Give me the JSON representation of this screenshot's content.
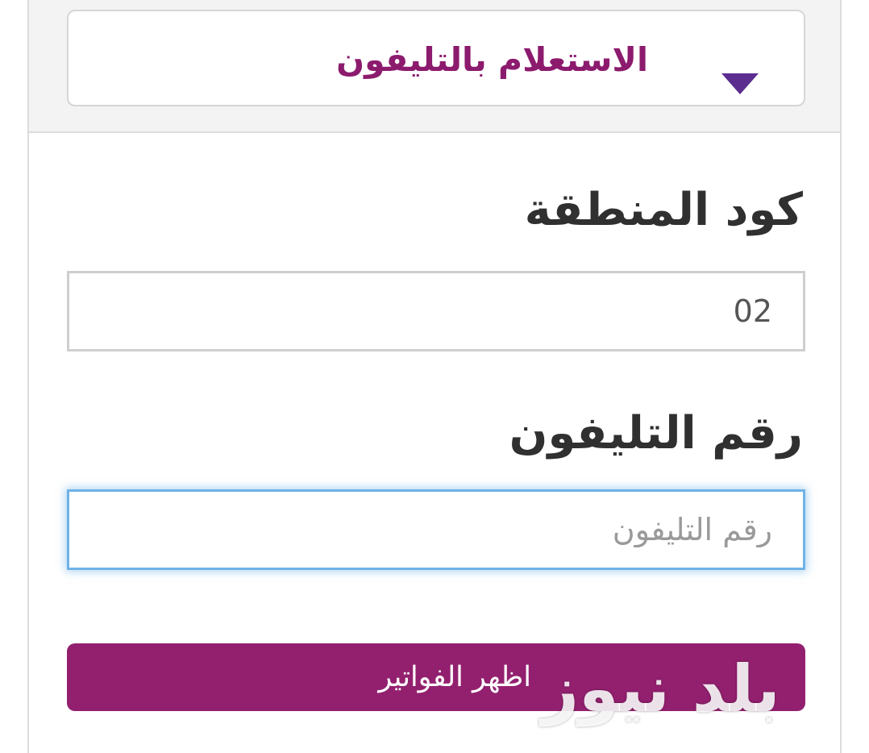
{
  "inquiry": {
    "method_label": "الاستعلام بالتليفون",
    "dropdown_icon": "triangle-down-icon",
    "accent_color": "#8c1b6e",
    "arrow_color": "#5a2d8f"
  },
  "form": {
    "area_code_label": "كود المنطقة",
    "area_code_value": "02",
    "phone_label": "رقم التليفون",
    "phone_placeholder": "رقم التليفون",
    "submit_label": "اظهر الفواتير",
    "button_color": "#93206f",
    "focus_color": "#6fb2e6"
  },
  "watermark": {
    "text": "بلد نيوز"
  }
}
